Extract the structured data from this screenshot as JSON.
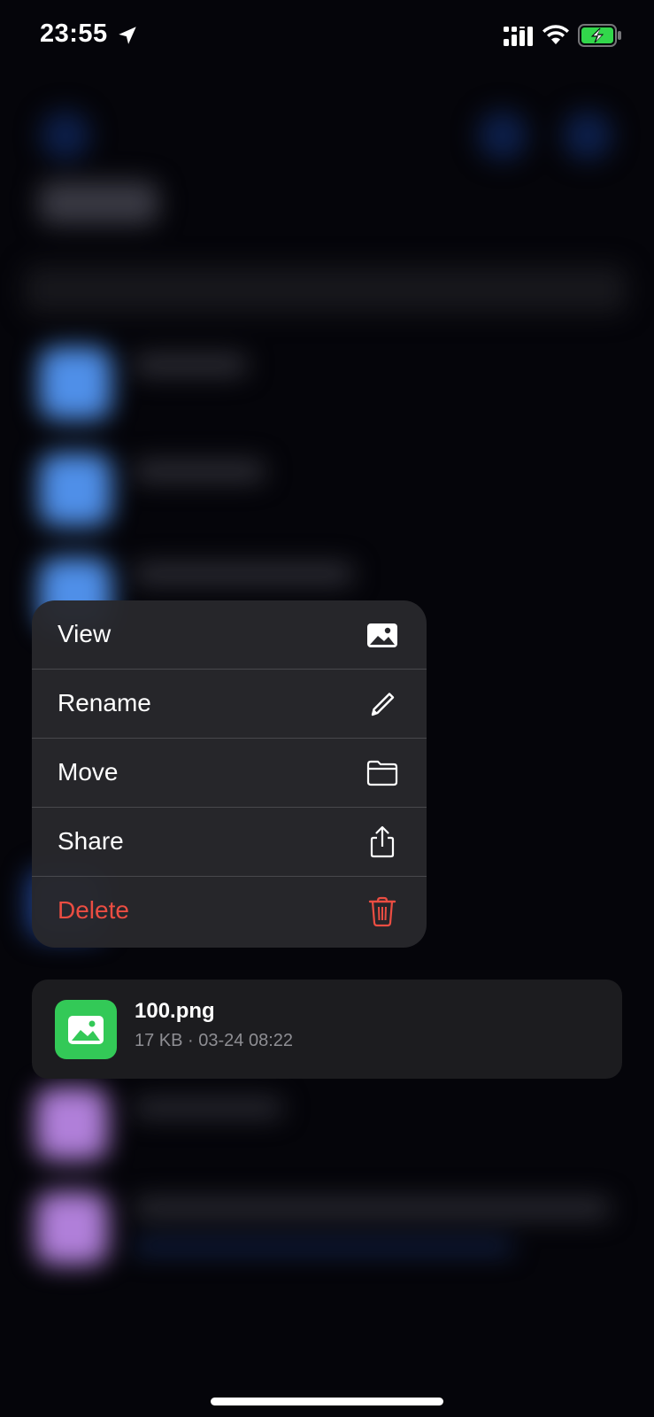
{
  "status_bar": {
    "time": "23:55",
    "icons": [
      "location-arrow-icon",
      "signal-icon",
      "wifi-icon",
      "battery-charging-icon"
    ],
    "battery_color": "#32d74b"
  },
  "context_menu": {
    "items": [
      {
        "label": "View",
        "icon": "image-icon",
        "color": "#ffffff"
      },
      {
        "label": "Rename",
        "icon": "pencil-icon",
        "color": "#ffffff"
      },
      {
        "label": "Move",
        "icon": "folder-icon",
        "color": "#ffffff"
      },
      {
        "label": "Share",
        "icon": "share-icon",
        "color": "#ffffff"
      },
      {
        "label": "Delete",
        "icon": "trash-icon",
        "color": "#eb4d42"
      }
    ]
  },
  "file": {
    "name": "100.png",
    "meta": "17 KB · 03-24 08:22",
    "thumb_icon": "image-icon",
    "thumb_color": "#33c957"
  },
  "colors": {
    "background": "#05050a",
    "menu_background": "#28282c",
    "danger": "#eb4d42",
    "accent": "#3b82f6"
  }
}
